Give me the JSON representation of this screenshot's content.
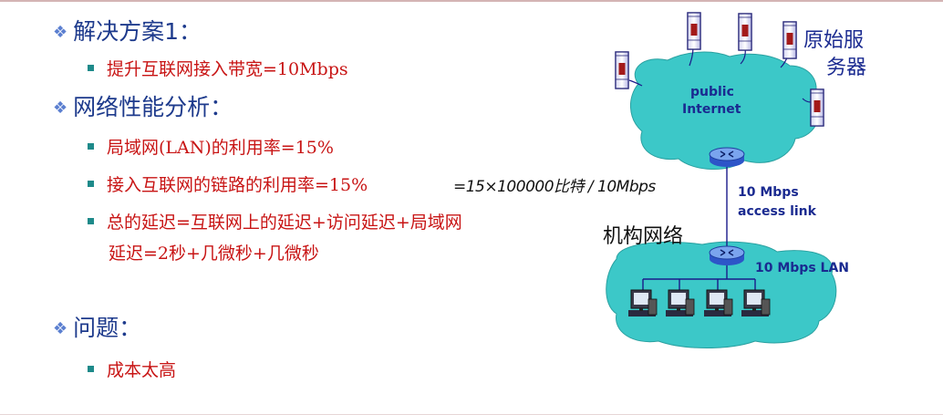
{
  "heading1": "解决方案1：",
  "solution_item": "提升互联网接入带宽=10Mbps",
  "heading2": "网络性能分析：",
  "analysis_items": [
    "局域网(LAN)的利用率=15%",
    "接入互联网的链路的利用率=15%",
    "总的延迟=互联网上的延迟+访问延迟+局域网",
    "延迟=2秒+几微秒+几微秒"
  ],
  "handwritten_note": "=15×100000比特 / 10Mbps",
  "heading3": "问题：",
  "problem_item": "成本太高",
  "diagram": {
    "internet_label_line1": "public",
    "internet_label_line2": "Internet",
    "servers_label_line1": "原始服",
    "servers_label_line2": "务器",
    "access_link_line1": "10 Mbps",
    "access_link_line2": "access link",
    "institution_label": "机构网络",
    "lan_label": "10 Mbps LAN"
  },
  "colors": {
    "heading": "#1d3a8c",
    "body_text": "#c81414",
    "bullet": "#1e8a8a",
    "cloud": "#3cc8c8",
    "diagram_text": "#1a2a90"
  },
  "icons": [
    "diamond-bullet-icon",
    "square-bullet-icon",
    "server-icon",
    "router-icon",
    "computer-icon"
  ]
}
